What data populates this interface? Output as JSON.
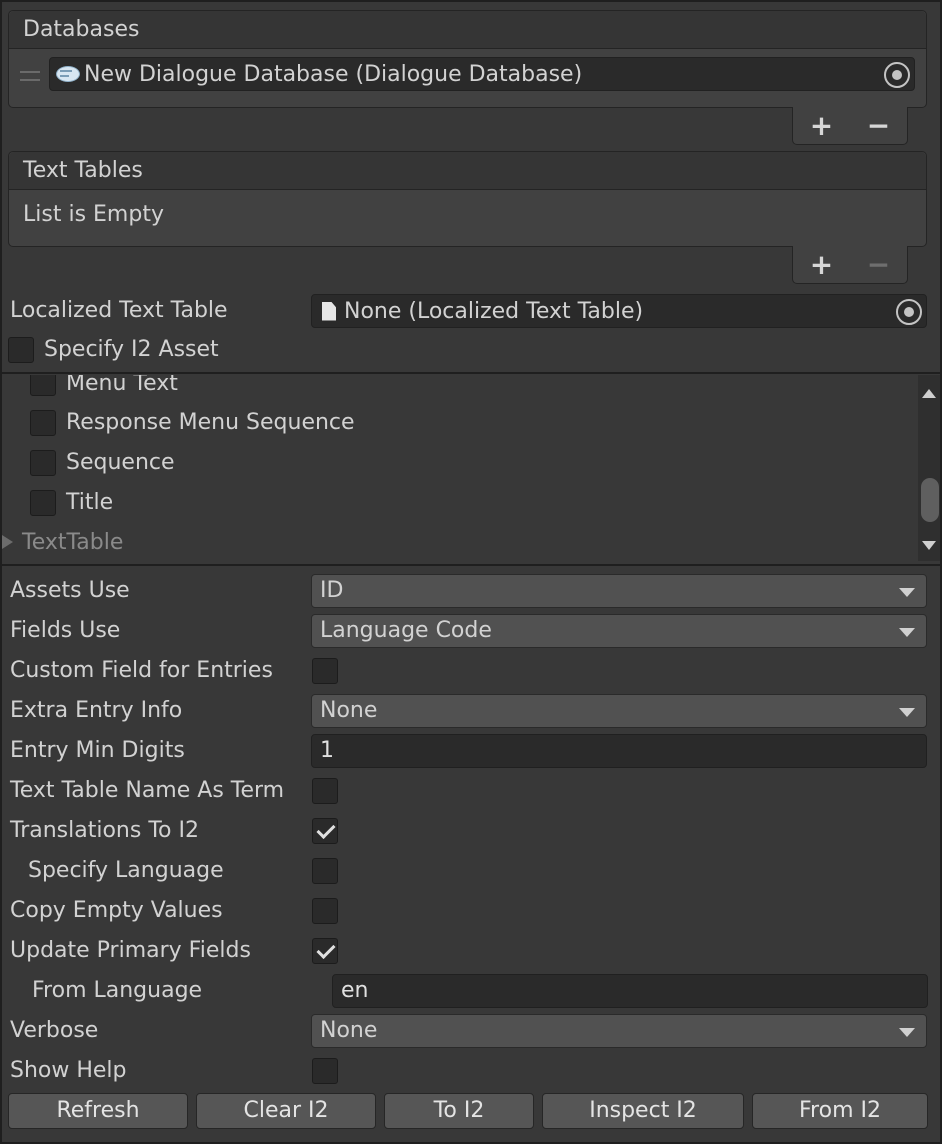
{
  "databases": {
    "header": "Databases",
    "items": [
      {
        "label": "New Dialogue Database (Dialogue Database)",
        "icon": "dialogue-database-icon"
      }
    ],
    "add_label": "+",
    "remove_label": "−"
  },
  "text_tables": {
    "header": "Text Tables",
    "empty_label": "List is Empty",
    "add_label": "+",
    "remove_label": "−"
  },
  "localized_text_table": {
    "label": "Localized Text Table",
    "value": "None (Localized Text Table)",
    "icon": "document-icon"
  },
  "specify_i2_asset": {
    "label": "Specify I2 Asset",
    "checked": false
  },
  "field_list": {
    "items": [
      {
        "label": "Menu Text",
        "checked": false
      },
      {
        "label": "Response Menu Sequence",
        "checked": false
      },
      {
        "label": "Sequence",
        "checked": false
      },
      {
        "label": "Title",
        "checked": false
      }
    ],
    "foldout": "TextTable"
  },
  "settings": {
    "assets_use": {
      "label": "Assets Use",
      "value": "ID"
    },
    "fields_use": {
      "label": "Fields Use",
      "value": "Language Code"
    },
    "custom_field_for_entries": {
      "label": "Custom Field for Entries",
      "checked": false
    },
    "extra_entry_info": {
      "label": "Extra Entry Info",
      "value": "None"
    },
    "entry_min_digits": {
      "label": "Entry Min Digits",
      "value": "1"
    },
    "text_table_name_as_term": {
      "label": "Text Table Name As Term",
      "checked": false
    },
    "translations_to_i2": {
      "label": "Translations To I2",
      "checked": true
    },
    "specify_language": {
      "label": "Specify Language",
      "checked": false
    },
    "copy_empty_values": {
      "label": "Copy Empty Values",
      "checked": false
    },
    "update_primary_fields": {
      "label": "Update Primary Fields",
      "checked": true
    },
    "from_language": {
      "label": "From Language",
      "value": "en"
    },
    "verbose": {
      "label": "Verbose",
      "value": "None"
    },
    "show_help": {
      "label": "Show Help",
      "checked": false
    }
  },
  "buttons": {
    "refresh": "Refresh",
    "clear_i2": "Clear I2",
    "to_i2": "To I2",
    "inspect_i2": "Inspect I2",
    "from_i2": "From I2"
  }
}
